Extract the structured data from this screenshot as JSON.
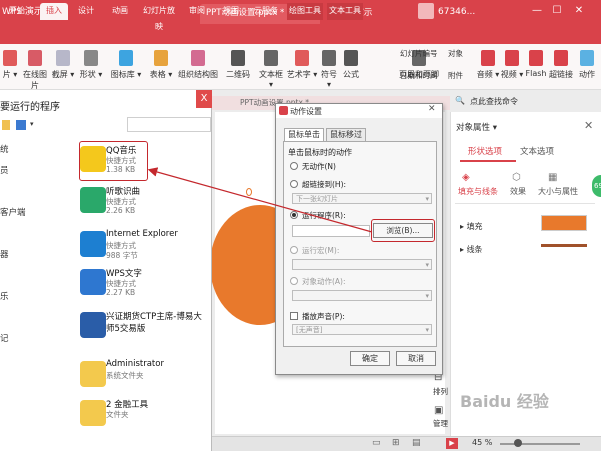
{
  "app": {
    "logo": "WPS 演示",
    "doc_tab": "PPT动画设置.pptx *",
    "window_title": "- WPS 演示",
    "user": "67346...",
    "colors": {
      "accent": "#d9424a",
      "shape": "#e8792c",
      "line": "#a0512a",
      "badge": "#3dbb6a"
    }
  },
  "menus": [
    "开始",
    "插入",
    "设计",
    "动画",
    "幻灯片放映",
    "审阅",
    "视图",
    "云服务",
    "绘图工具",
    "文本工具"
  ],
  "ribbon": [
    {
      "label": "片 ▾",
      "icon": "picture-icon"
    },
    {
      "label": "在线图片",
      "icon": "online-picture-icon"
    },
    {
      "label": "截屏 ▾",
      "icon": "screenshot-icon"
    },
    {
      "label": "形状 ▾",
      "icon": "shape-icon"
    },
    {
      "label": "图标库 ▾",
      "icon": "icon-library-icon"
    },
    {
      "label": "表格 ▾",
      "icon": "table-icon"
    },
    {
      "label": "组织结构图",
      "icon": "org-chart-icon"
    },
    {
      "label": "二维码",
      "icon": "qrcode-icon"
    },
    {
      "label": "文本框 ▾",
      "icon": "textbox-icon"
    },
    {
      "label": "艺术字 ▾",
      "icon": "wordart-icon"
    },
    {
      "label": "符号 ▾",
      "icon": "symbol-icon"
    },
    {
      "label": "公式",
      "icon": "formula-icon"
    },
    {
      "label": "页眉和页脚",
      "icon": "header-footer-icon"
    },
    {
      "label": "音频 ▾",
      "icon": "audio-icon"
    },
    {
      "label": "视频 ▾",
      "icon": "video-icon"
    },
    {
      "label": "Flash",
      "icon": "flash-icon"
    },
    {
      "label": "超链接",
      "icon": "hyperlink-icon"
    },
    {
      "label": "动作",
      "icon": "action-icon"
    }
  ],
  "ribbon_small": [
    "幻灯片编号",
    "对象",
    "日期和时间",
    "附件"
  ],
  "search_hint": "点此查找命令",
  "picker": {
    "title": "要运行的程序",
    "files": [
      {
        "name": "QQ音乐",
        "sub1": "快捷方式",
        "sub2": "1.38 KB",
        "icon": "qqmusic-icon",
        "color": "#f4c81c"
      },
      {
        "name": "听歌识曲",
        "sub1": "快捷方式",
        "sub2": "2.26 KB",
        "icon": "music-recognize-icon",
        "color": "#2aa86a"
      },
      {
        "name": "Internet Explorer",
        "sub1": "快捷方式",
        "sub2": "988 字节",
        "icon": "ie-icon",
        "color": "#1d7fd1"
      },
      {
        "name": "WPS文字",
        "sub1": "快捷方式",
        "sub2": "2.27 KB",
        "icon": "wps-writer-icon",
        "color": "#2e77d0"
      },
      {
        "name": "兴证期货CTP主席-博易大师5交易版",
        "sub1": "",
        "sub2": "",
        "icon": "trading-app-icon",
        "color": "#2a5da8"
      },
      {
        "name": "Administrator",
        "sub1": "系统文件夹",
        "sub2": "",
        "icon": "folder-icon",
        "color": "#f3c94d"
      },
      {
        "name": "2 金融工具",
        "sub1": "文件夹",
        "sub2": "",
        "icon": "folder-icon",
        "color": "#f3c94d"
      }
    ],
    "left_labels": [
      "统",
      "员",
      "",
      "客户端",
      "",
      "器",
      "",
      "乐",
      "",
      "记",
      ""
    ]
  },
  "dialog": {
    "title": "动作设置",
    "tabs": [
      "鼠标单击",
      "鼠标移过"
    ],
    "group": "单击鼠标时的动作",
    "options": [
      "无动作(N)",
      "超链接到(H):",
      "运行程序(R):",
      "运行宏(M):",
      "对象动作(A):"
    ],
    "hyperlink_value": "下一张幻灯片",
    "browse": "浏览(B)...",
    "sound_label": "播放声音(P):",
    "sound_value": "[无声音]",
    "ok": "确定",
    "cancel": "取消"
  },
  "pane": {
    "title": "对象属性 ▾",
    "tabs": [
      "形状选项",
      "文本选项"
    ],
    "subtabs": [
      "填充与线条",
      "效果",
      "大小与属性"
    ],
    "fill": "填充",
    "line": "线条",
    "badge": "69"
  },
  "tools": {
    "array": "排列",
    "manage": "管理"
  },
  "status": {
    "zoom": "45 %",
    "watermark": "Baidu 经验"
  }
}
